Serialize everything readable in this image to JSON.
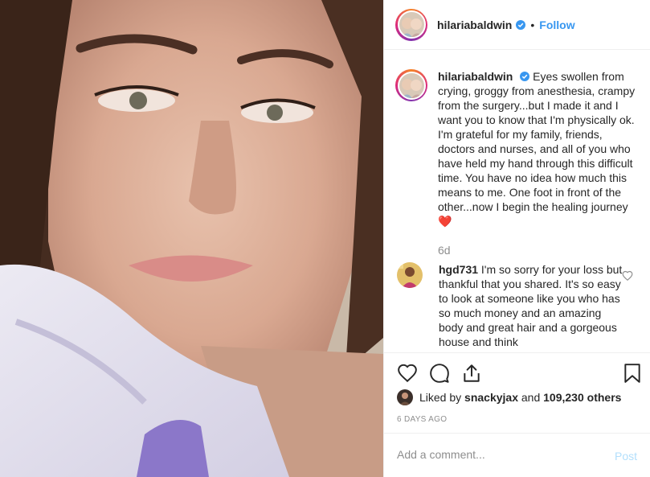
{
  "post": {
    "username": "hilariabaldwin",
    "separator": "•",
    "follow_label": "Follow",
    "caption_text": "Eyes swollen from crying, groggy from anesthesia, crampy from the surgery...but I made it and I want you to know that I'm physically ok. I'm grateful for my family, friends, doctors and nurses, and all of you who have held my hand through this difficult time. You have no idea how much this means to me. One foot in front of the other...now I begin the healing journey ❤️",
    "caption_age": "6d"
  },
  "comment": {
    "username": "hgd731",
    "text": "I'm so sorry for your loss but thankful that you shared. It's so easy to look at someone like you who has so much money and an amazing body and great hair and a gorgeous house and think"
  },
  "likes": {
    "prefix": "Liked by",
    "user": "snackyjax",
    "and": "and",
    "count": "109,230 others"
  },
  "timestamp": "6 DAYS AGO",
  "add_comment": {
    "placeholder": "Add a comment...",
    "post_label": "Post"
  },
  "icons": {
    "verified": "verified-badge-icon",
    "like": "heart-icon",
    "comment": "comment-bubble-icon",
    "share": "share-icon",
    "save": "bookmark-icon"
  },
  "colors": {
    "link_blue": "#3897f0",
    "post_disabled": "#b2dffc",
    "muted": "#8e8e8e",
    "heart_red": "#ed4956"
  }
}
